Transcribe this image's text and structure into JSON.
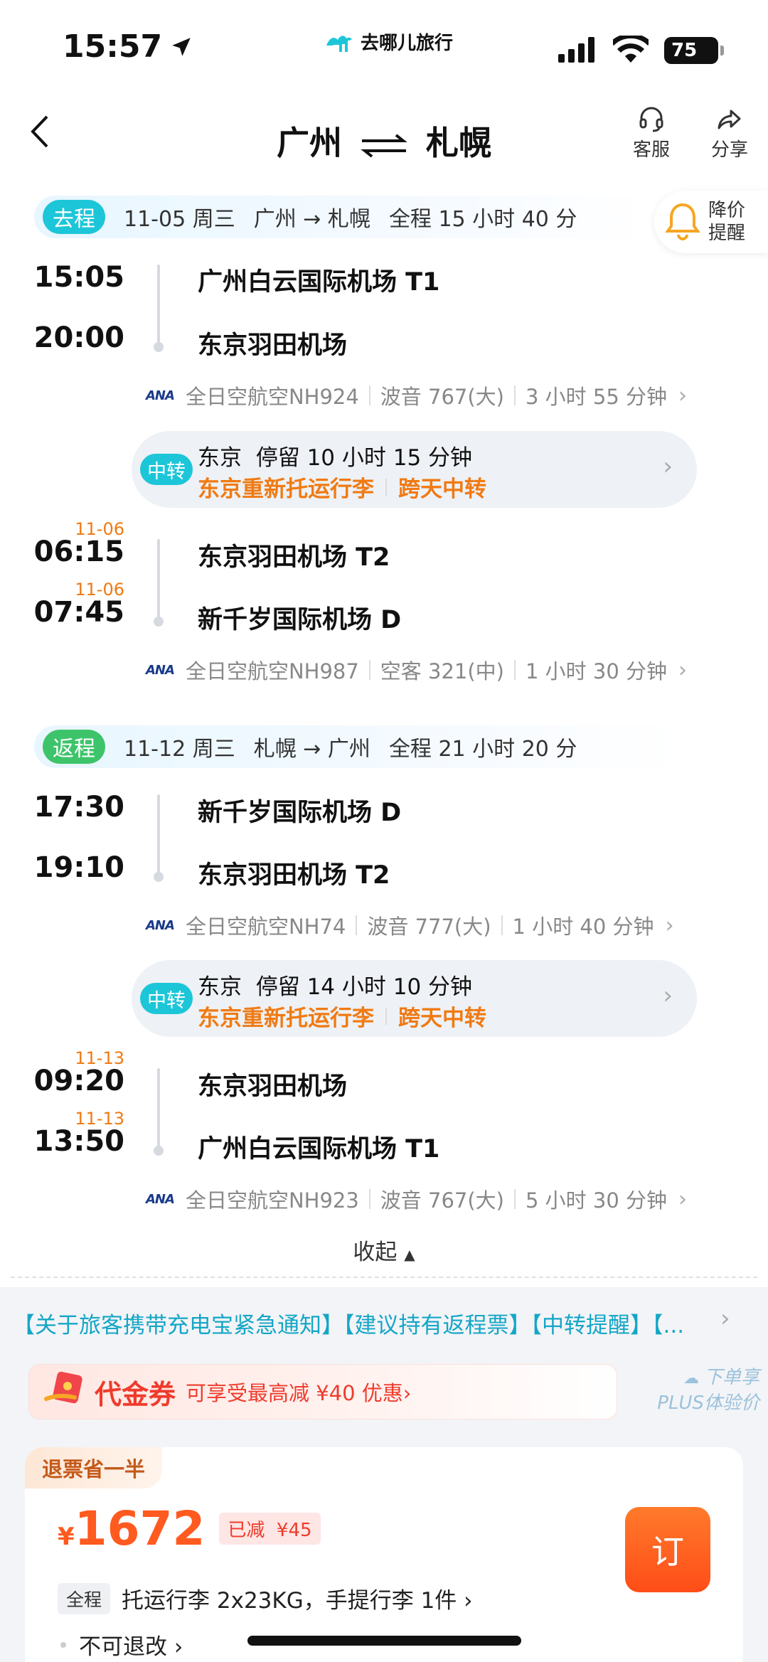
{
  "status_bar": {
    "time": "15:57",
    "battery": "75"
  },
  "brand": {
    "name": "去哪儿旅行"
  },
  "header": {
    "title_from": "广州",
    "title_to": "札幌",
    "service_label": "客服",
    "share_label": "分享"
  },
  "price_alert": {
    "line1": "降价",
    "line2": "提醒"
  },
  "outbound": {
    "tag": "去程",
    "date": "11-05 周三",
    "route": "广州 → 札幌",
    "duration": "全程 15 小时 40 分",
    "leg1": {
      "dep_time": "15:05",
      "dep_airport": "广州白云国际机场 T1",
      "arr_time": "20:00",
      "arr_airport": "东京羽田机场",
      "airline": "全日空航空NH924",
      "aircraft": "波音 767(大)",
      "flight_duration": "3 小时 55 分钟"
    },
    "transfer": {
      "tag": "中转",
      "city": "东京",
      "stay": "停留 10 小时 15 分钟",
      "note1": "东京重新托运行李",
      "note2": "跨天中转"
    },
    "leg2": {
      "dep_date": "11-06",
      "dep_time": "06:15",
      "dep_airport": "东京羽田机场 T2",
      "arr_date": "11-06",
      "arr_time": "07:45",
      "arr_airport": "新千岁国际机场 D",
      "airline": "全日空航空NH987",
      "aircraft": "空客 321(中)",
      "flight_duration": "1 小时 30 分钟"
    }
  },
  "return": {
    "tag": "返程",
    "date": "11-12 周三",
    "route": "札幌 → 广州",
    "duration": "全程 21 小时 20 分",
    "leg1": {
      "dep_time": "17:30",
      "dep_airport": "新千岁国际机场 D",
      "arr_time": "19:10",
      "arr_airport": "东京羽田机场 T2",
      "airline": "全日空航空NH74",
      "aircraft": "波音 777(大)",
      "flight_duration": "1 小时 40 分钟"
    },
    "transfer": {
      "tag": "中转",
      "city": "东京",
      "stay": "停留 14 小时 10 分钟",
      "note1": "东京重新托运行李",
      "note2": "跨天中转"
    },
    "leg2": {
      "dep_date": "11-13",
      "dep_time": "09:20",
      "dep_airport": "东京羽田机场",
      "arr_date": "11-13",
      "arr_time": "13:50",
      "arr_airport": "广州白云国际机场 T1",
      "airline": "全日空航空NH923",
      "aircraft": "波音 767(大)",
      "flight_duration": "5 小时 30 分钟"
    }
  },
  "collapse_label": "收起",
  "notice": "【关于旅客携带充电宝紧急通知】【建议持有返程票】【中转提醒】【...",
  "voucher": {
    "title": "代金券",
    "desc": "可享受最高减 ¥40 优惠›",
    "side_line1": "下单享",
    "side_line2": "PLUS体验价"
  },
  "price_card": {
    "badge": "退票省一半",
    "currency": "¥",
    "price": "1672",
    "discount_label": "已减",
    "discount_value": "¥45",
    "baggage_tag": "全程",
    "baggage": "托运行李 2x23KG，手提行李 1件 ›",
    "refund": "不可退改 ›",
    "book_label": "订"
  },
  "colors": {
    "accent_orange": "#f07a13",
    "tag_blue": "#1cc6d8",
    "tag_green": "#3dc46a",
    "book_button": "#ff5a1f"
  }
}
